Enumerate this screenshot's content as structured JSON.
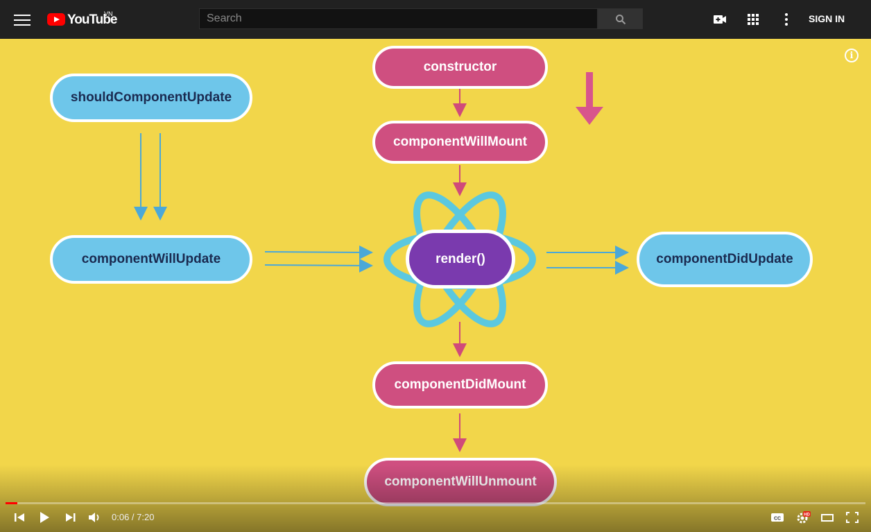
{
  "header": {
    "brand": "YouTube",
    "region": "VN",
    "search_placeholder": "Search",
    "sign_in": "SIGN IN"
  },
  "icons": {
    "menu": "menu-icon",
    "search": "search-icon",
    "create_video": "video-camera-plus-icon",
    "apps": "apps-grid-icon",
    "more": "more-vertical-icon",
    "info": "info-icon"
  },
  "diagram": {
    "nodes": {
      "constructor": "constructor",
      "will_mount": "componentWillMount",
      "render": "render()",
      "did_mount": "componentDidMount",
      "will_unmount": "componentWillUnmount",
      "should_update": "shouldComponentUpdate",
      "will_update": "componentWillUpdate",
      "did_update": "componentDidUpdate"
    },
    "colors": {
      "background": "#f2d64a",
      "mount_nodes": "#cf4f80",
      "update_nodes": "#6ec6ea",
      "render_node": "#7a3aae",
      "react_atom": "#5bc8df",
      "mount_arrows": "#d04a7a",
      "update_arrows": "#4ba8d8"
    }
  },
  "player": {
    "current_time": "0:06",
    "duration": "7:20",
    "time_separator": " / ",
    "progress_fraction": 0.014,
    "quality_badge": "HD",
    "info_glyph": "i"
  }
}
